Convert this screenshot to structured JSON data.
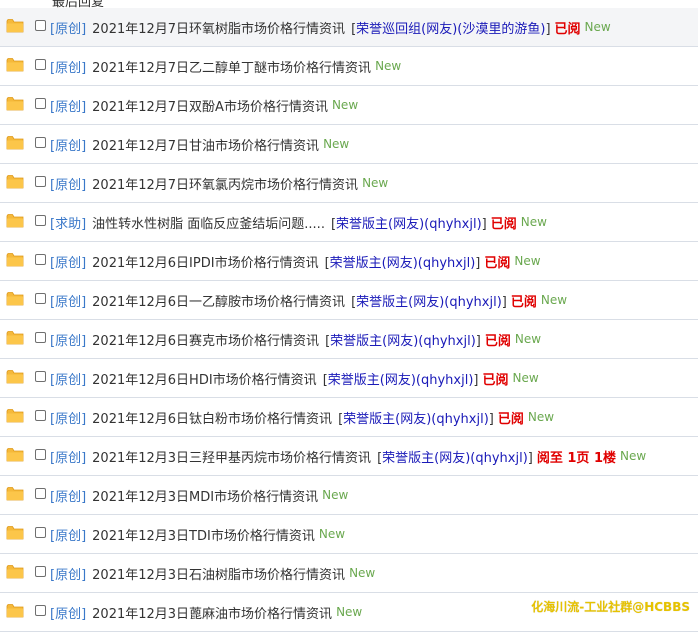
{
  "header_fragment": "最后回复",
  "rows": [
    {
      "cat": "[原创]",
      "title": "2021年12月7日环氧树脂市场价格行情资讯",
      "user": "荣誉巡回组(网友)(沙漠里的游鱼)",
      "status": "已阅",
      "new": "New"
    },
    {
      "cat": "[原创]",
      "title": "2021年12月7日乙二醇单丁醚市场价格行情资讯",
      "new": "New"
    },
    {
      "cat": "[原创]",
      "title": "2021年12月7日双酚A市场价格行情资讯",
      "new": "New"
    },
    {
      "cat": "[原创]",
      "title": "2021年12月7日甘油市场价格行情资讯",
      "new": "New"
    },
    {
      "cat": "[原创]",
      "title": "2021年12月7日环氧氯丙烷市场价格行情资讯",
      "new": "New"
    },
    {
      "cat": "[求助]",
      "title": "油性转水性树脂 面临反应釜结垢问题.....",
      "user": "荣誉版主(网友)(qhyhxjl)",
      "status": "已阅",
      "new": "New"
    },
    {
      "cat": "[原创]",
      "title": "2021年12月6日IPDI市场价格行情资讯",
      "user": "荣誉版主(网友)(qhyhxjl)",
      "status": "已阅",
      "new": "New"
    },
    {
      "cat": "[原创]",
      "title": "2021年12月6日一乙醇胺市场价格行情资讯",
      "user": "荣誉版主(网友)(qhyhxjl)",
      "status": "已阅",
      "new": "New"
    },
    {
      "cat": "[原创]",
      "title": "2021年12月6日赛克市场价格行情资讯",
      "user": "荣誉版主(网友)(qhyhxjl)",
      "status": "已阅",
      "new": "New"
    },
    {
      "cat": "[原创]",
      "title": "2021年12月6日HDI市场价格行情资讯",
      "user": "荣誉版主(网友)(qhyhxjl)",
      "status": "已阅",
      "new": "New"
    },
    {
      "cat": "[原创]",
      "title": "2021年12月6日钛白粉市场价格行情资讯",
      "user": "荣誉版主(网友)(qhyhxjl)",
      "status": "已阅",
      "new": "New"
    },
    {
      "cat": "[原创]",
      "title": "2021年12月3日三羟甲基丙烷市场价格行情资讯",
      "user": "荣誉版主(网友)(qhyhxjl)",
      "status": "阅至 1页 1楼",
      "new": "New"
    },
    {
      "cat": "[原创]",
      "title": "2021年12月3日MDI市场价格行情资讯",
      "new": "New"
    },
    {
      "cat": "[原创]",
      "title": "2021年12月3日TDI市场价格行情资讯",
      "new": "New"
    },
    {
      "cat": "[原创]",
      "title": "2021年12月3日石油树脂市场价格行情资讯",
      "new": "New"
    },
    {
      "cat": "[原创]",
      "title": "2021年12月3日蓖麻油市场价格行情资讯",
      "new": "New"
    }
  ],
  "watermark": "化海川流-工业社群@HCBBS",
  "colors": {
    "category": "#3a78c9",
    "user": "#1a1ab8",
    "status": "#e00000",
    "new": "#6aa84f",
    "folder": "#f5b93b"
  }
}
